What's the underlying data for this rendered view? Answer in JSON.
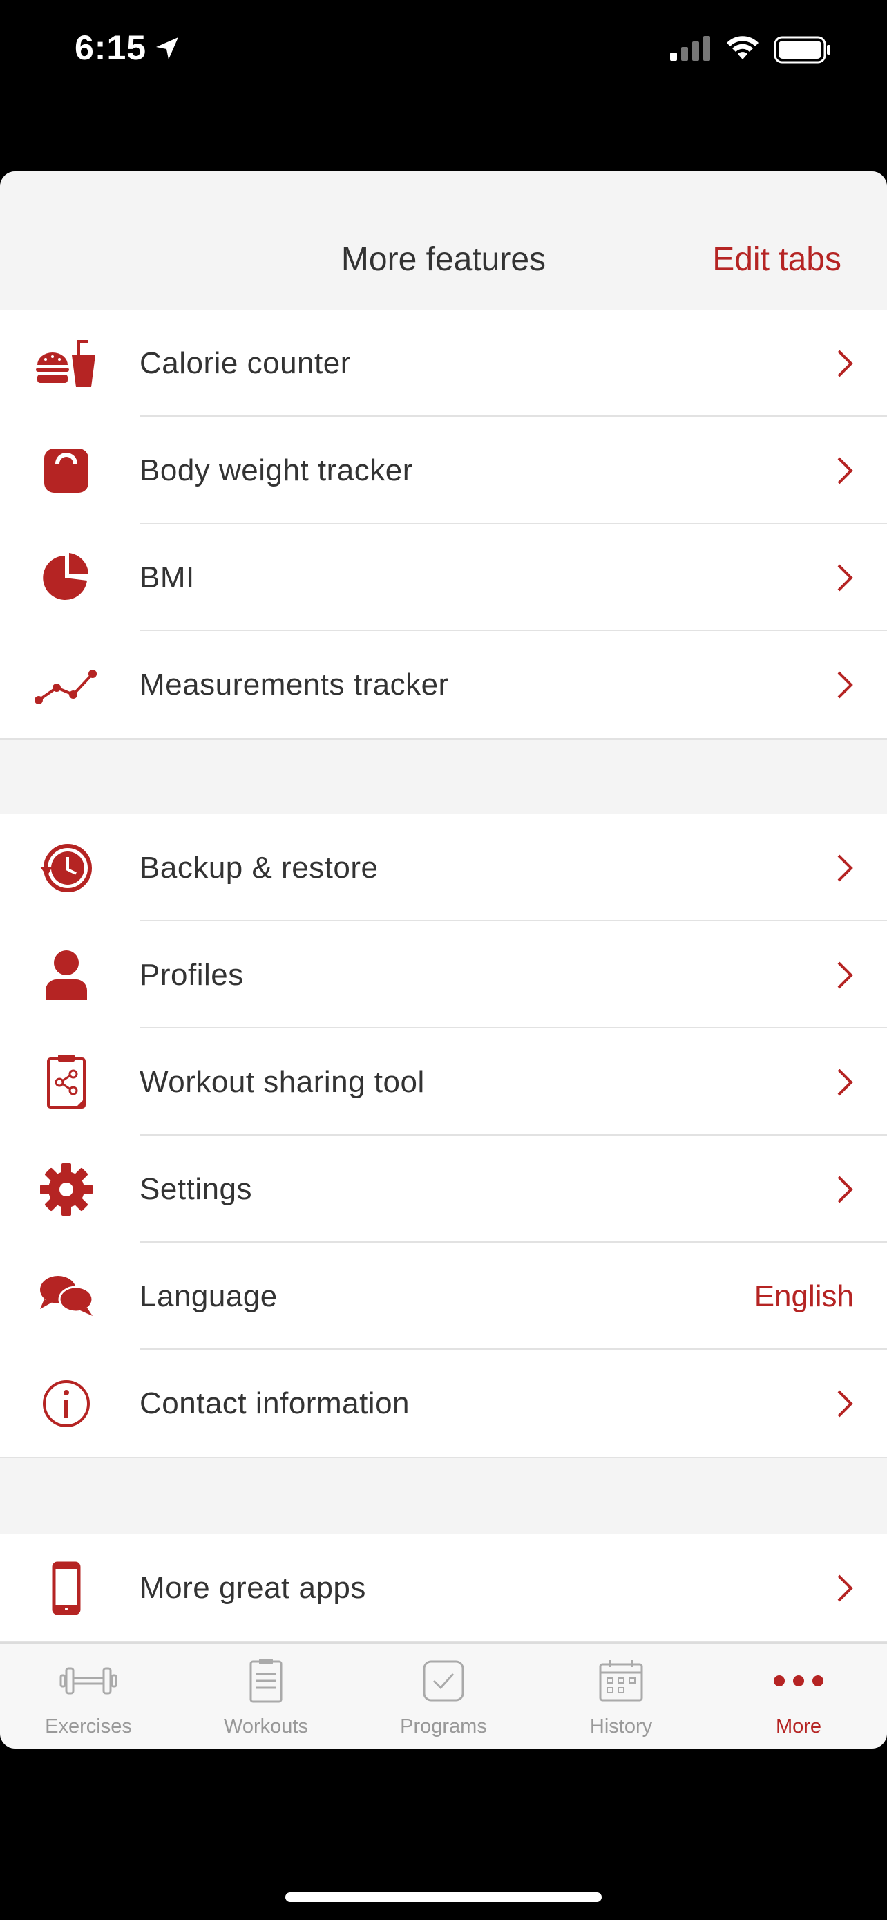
{
  "status": {
    "time": "6:15"
  },
  "header": {
    "title": "More features",
    "edit_tabs": "Edit tabs"
  },
  "group1": [
    {
      "label": "Calorie counter",
      "icon": "burger-drink-icon"
    },
    {
      "label": "Body weight tracker",
      "icon": "scale-icon"
    },
    {
      "label": "BMI",
      "icon": "pie-chart-icon"
    },
    {
      "label": "Measurements tracker",
      "icon": "line-graph-icon"
    }
  ],
  "group2": [
    {
      "label": "Backup & restore",
      "icon": "backup-clock-icon"
    },
    {
      "label": "Profiles",
      "icon": "person-icon"
    },
    {
      "label": "Workout sharing tool",
      "icon": "share-clipboard-icon"
    },
    {
      "label": "Settings",
      "icon": "gear-icon"
    },
    {
      "label": "Language",
      "value": "English",
      "icon": "chat-bubbles-icon"
    },
    {
      "label": "Contact information",
      "icon": "info-icon"
    }
  ],
  "group3": [
    {
      "label": "More great apps",
      "icon": "phone-icon"
    }
  ],
  "tabs": [
    {
      "label": "Exercises",
      "icon": "dumbbell-icon"
    },
    {
      "label": "Workouts",
      "icon": "clipboard-icon"
    },
    {
      "label": "Programs",
      "icon": "checkbox-icon"
    },
    {
      "label": "History",
      "icon": "calendar-icon"
    },
    {
      "label": "More",
      "icon": "more-dots-icon",
      "active": true
    }
  ],
  "colors": {
    "accent": "#b52423",
    "text": "#333333",
    "inactive": "#999999"
  }
}
